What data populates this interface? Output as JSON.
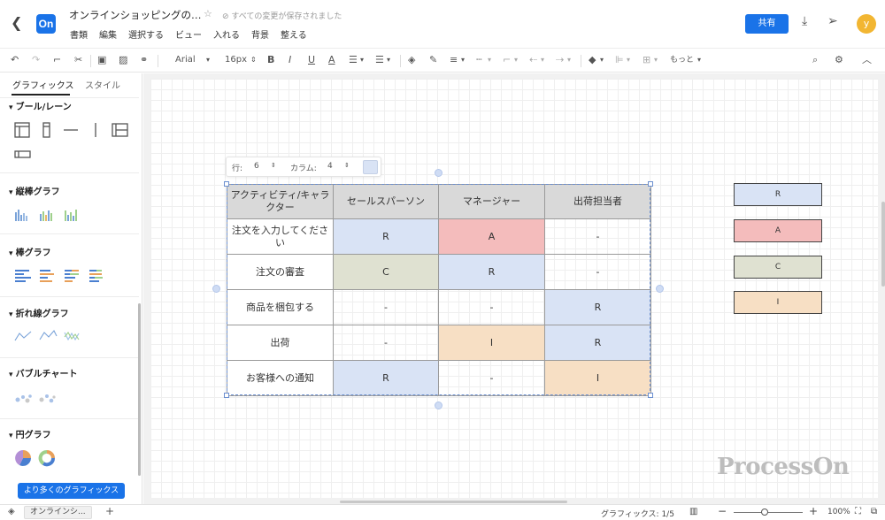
{
  "header": {
    "back_icon": "back-arrow-icon",
    "logo_text": "On",
    "title": "オンラインショッピングの…",
    "saved_status": "すべての変更が保存されました",
    "menu": [
      "書類",
      "編集",
      "選択する",
      "ビュー",
      "入れる",
      "背景",
      "整える"
    ],
    "share_label": "共有",
    "avatar_letter": "y"
  },
  "toolbar": {
    "font": "Arial",
    "font_size": "16px",
    "more_label": "もっと"
  },
  "sidebar": {
    "tabs": [
      "グラフィックス",
      "スタイル"
    ],
    "sections": [
      "ブール/レーン",
      "縦棒グラフ",
      "棒グラフ",
      "折れ線グラフ",
      "バブルチャート",
      "円グラフ"
    ],
    "more_button": "より多くのグラフィックス"
  },
  "table_toolbar": {
    "rows_label": "行:",
    "rows_value": "6",
    "cols_label": "カラム:",
    "cols_value": "4"
  },
  "table": {
    "headers": [
      "アクティビティ/キャラクター",
      "セールスパーソン",
      "マネージャー",
      "出荷担当者"
    ],
    "rows": [
      {
        "activity": "注文を入力してください",
        "cells": [
          "R",
          "A",
          "-"
        ]
      },
      {
        "activity": "注文の審査",
        "cells": [
          "C",
          "R",
          "-"
        ]
      },
      {
        "activity": "商品を梱包する",
        "cells": [
          "-",
          "-",
          "R"
        ]
      },
      {
        "activity": "出荷",
        "cells": [
          "-",
          "I",
          "R"
        ]
      },
      {
        "activity": "お客様への通知",
        "cells": [
          "R",
          "-",
          "I"
        ]
      }
    ]
  },
  "legend": [
    {
      "label": "R",
      "color": "#d9e3f5"
    },
    {
      "label": "A",
      "color": "#f4bcbc"
    },
    {
      "label": "C",
      "color": "#dfe1d1"
    },
    {
      "label": "I",
      "color": "#f7dfc4"
    }
  ],
  "colors": {
    "R": "#d9e3f5",
    "A": "#f4bcbc",
    "C": "#dfe1d1",
    "I": "#f7dfc4",
    "header": "#d9d9d9",
    "accent": "#1a73e8"
  },
  "watermark": "ProcessOn",
  "statusbar": {
    "page_tab": "オンラインシ...",
    "add_icon": "plus-icon",
    "graphics_count": "グラフィックス: 1/5",
    "zoom": "100%"
  }
}
